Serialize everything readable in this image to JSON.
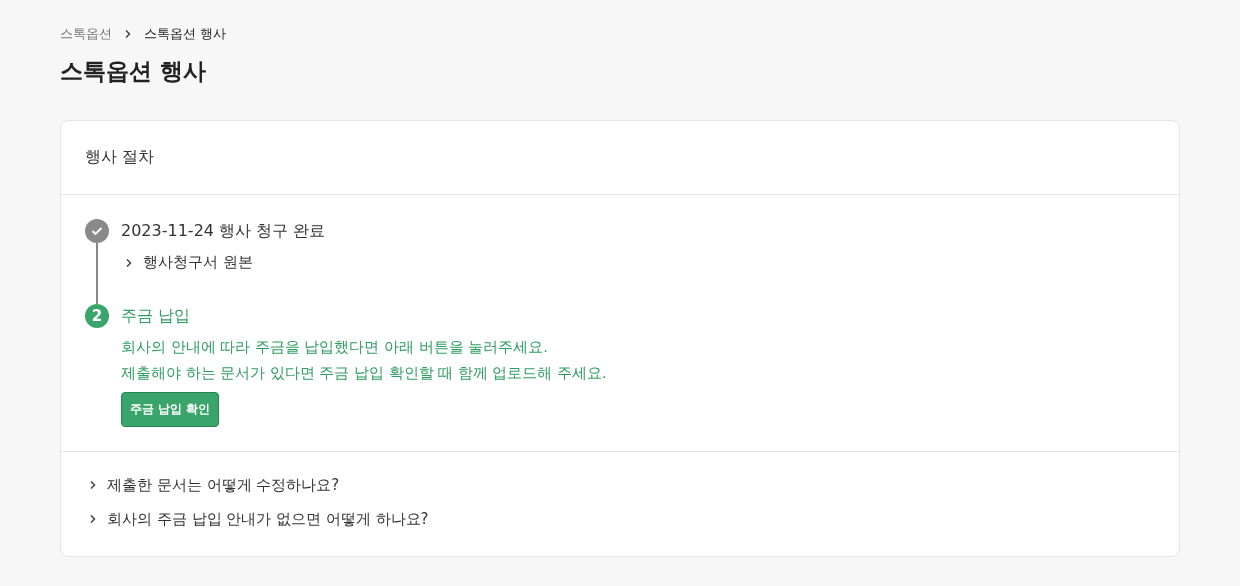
{
  "breadcrumb": [
    {
      "label": "스톡옵션"
    },
    {
      "label": "스톡옵션 행사"
    }
  ],
  "title": "스톡옵션 행사",
  "card": {
    "title": "행사 절차",
    "steps": [
      {
        "kind": "done",
        "title": "2023-11-24 행사 청구 완료",
        "links": [
          "행사청구서 원본"
        ]
      },
      {
        "kind": "current",
        "marker": "2",
        "title": "주금 납입",
        "description": [
          "회사의 안내에 따라 주금을 납입했다면 아래 버튼을 눌러주세요.",
          "제출해야 하는 문서가 있다면 주금 납입 확인할 때 함께 업로드해 주세요."
        ],
        "button": "주금 납입 확인"
      }
    ],
    "faq": [
      "제출한 문서는 어떻게 수정하나요?",
      "회사의 주금 납입 안내가 없으면 어떻게 하나요?"
    ]
  }
}
